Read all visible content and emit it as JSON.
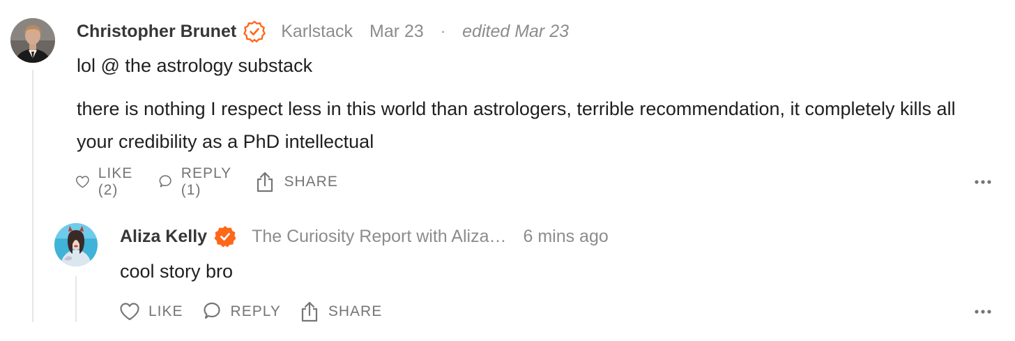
{
  "comments": [
    {
      "author": "Christopher Brunet",
      "publication": "Karlstack",
      "date": "Mar 23",
      "separator": "·",
      "edited": "edited Mar 23",
      "paragraphs": [
        "lol @ the astrology substack",
        "there is nothing I respect less in this world than astrologers, terrible recommendation, it completely kills all your credibility as a PhD intellectual"
      ],
      "like_label": "LIKE (2)",
      "reply_label": "REPLY (1)",
      "share_label": "SHARE",
      "badge_style": "outline"
    },
    {
      "author": "Aliza Kelly",
      "publication": "The Curiosity Report with Aliza…",
      "date": "6 mins ago",
      "paragraphs": [
        "cool story bro"
      ],
      "like_label": "LIKE",
      "reply_label": "REPLY",
      "share_label": "SHARE",
      "badge_style": "filled"
    }
  ],
  "icons": {
    "like": "heart-icon",
    "reply": "speech-bubble-icon",
    "share": "share-icon",
    "more": "more-dots-icon",
    "verified": "verified-badge-icon"
  },
  "colors": {
    "accent": "#FF6719",
    "muted": "#8C8C8C",
    "text": "#1F1F1F",
    "thread_line": "#E6E6E6"
  }
}
